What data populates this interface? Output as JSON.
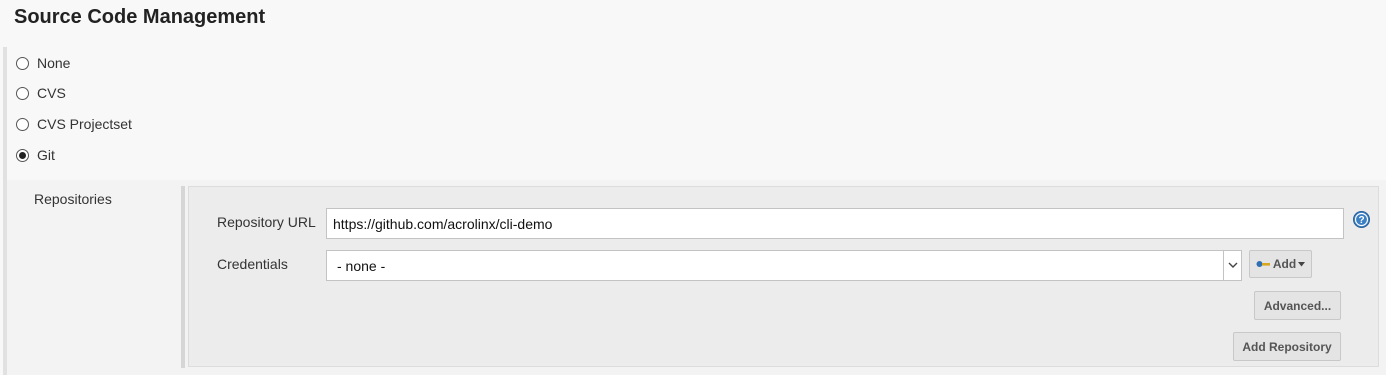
{
  "section": {
    "title": "Source Code Management"
  },
  "scm_options": [
    {
      "label": "None",
      "selected": false
    },
    {
      "label": "CVS",
      "selected": false
    },
    {
      "label": "CVS Projectset",
      "selected": false
    },
    {
      "label": "Git",
      "selected": true
    }
  ],
  "git": {
    "repositories_label": "Repositories",
    "repository_url": {
      "label": "Repository URL",
      "value": "https://github.com/acrolinx/cli-demo"
    },
    "credentials": {
      "label": "Credentials",
      "selected": "- none -"
    },
    "add_button": {
      "label": "Add",
      "icon": "key-icon"
    },
    "advanced_button": "Advanced...",
    "add_repository_button": "Add Repository",
    "help_icon": "help-icon"
  },
  "colors": {
    "background": "#f8f8f8",
    "panel": "#ececec",
    "help_icon": "#3b7fc4"
  }
}
